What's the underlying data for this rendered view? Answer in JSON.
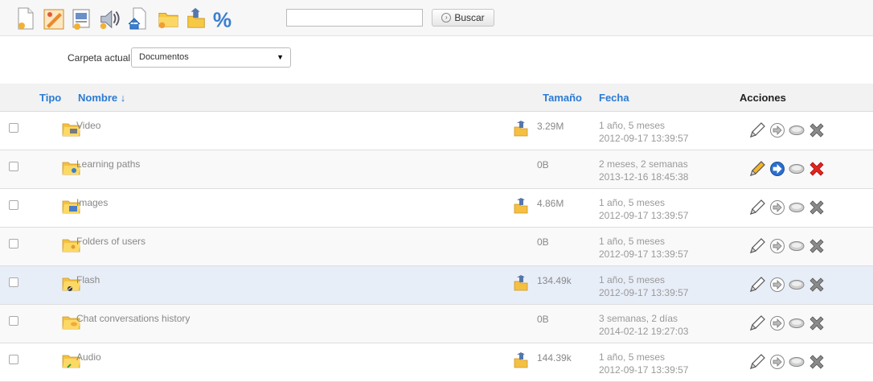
{
  "toolbar": {
    "icons": [
      {
        "name": "new-document-icon"
      },
      {
        "name": "create-drawing-icon"
      },
      {
        "name": "template-icon"
      },
      {
        "name": "audio-recorder-icon"
      },
      {
        "name": "document-home-icon"
      },
      {
        "name": "new-folder-icon"
      },
      {
        "name": "upload-icon"
      },
      {
        "name": "quota-percent-icon"
      }
    ],
    "search": {
      "value": "",
      "placeholder": ""
    },
    "search_button_label": "Buscar"
  },
  "folder": {
    "label": "Carpeta actual",
    "selected": "Documentos"
  },
  "table": {
    "headers": {
      "type": "Tipo",
      "name": "Nombre ↓",
      "size": "Tamaño",
      "date": "Fecha",
      "actions": "Acciones"
    },
    "rows": [
      {
        "name": "Video",
        "size": "3.29M",
        "date_relative": "1 año, 5 meses",
        "date": "2012-09-17 13:39:57",
        "icon": "folder-video-icon",
        "has_download": true,
        "active": false
      },
      {
        "name": "Learning paths",
        "size": "0B",
        "date_relative": "2 meses, 2 semanas",
        "date": "2013-12-16 18:45:38",
        "icon": "folder-shared-icon",
        "has_download": false,
        "active": true
      },
      {
        "name": "Images",
        "size": "4.86M",
        "date_relative": "1 año, 5 meses",
        "date": "2012-09-17 13:39:57",
        "icon": "folder-images-icon",
        "has_download": true,
        "active": false
      },
      {
        "name": "Folders of users",
        "size": "0B",
        "date_relative": "1 año, 5 meses",
        "date": "2012-09-17 13:39:57",
        "icon": "folder-users-icon",
        "has_download": false,
        "active": false
      },
      {
        "name": "Flash",
        "size": "134.49k",
        "date_relative": "1 año, 5 meses",
        "date": "2012-09-17 13:39:57",
        "icon": "folder-flash-icon",
        "has_download": true,
        "active": false
      },
      {
        "name": "Chat conversations history",
        "size": "0B",
        "date_relative": "3 semanas, 2 días",
        "date": "2014-02-12 19:27:03",
        "icon": "folder-chat-icon",
        "has_download": false,
        "active": false
      },
      {
        "name": "Audio",
        "size": "144.39k",
        "date_relative": "1 año, 5 meses",
        "date": "2012-09-17 13:39:57",
        "icon": "folder-audio-icon",
        "has_download": true,
        "active": false
      }
    ]
  }
}
